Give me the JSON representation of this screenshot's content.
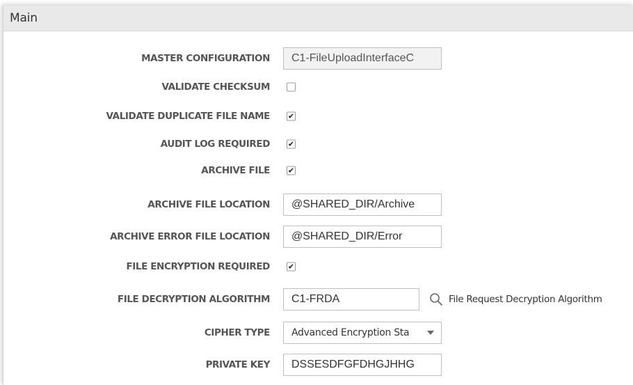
{
  "section": {
    "title": "Main"
  },
  "fields": {
    "master_configuration": {
      "label": "MASTER CONFIGURATION",
      "value": "C1-FileUploadInterfaceC"
    },
    "validate_checksum": {
      "label": "VALIDATE CHECKSUM",
      "checked": false
    },
    "validate_duplicate_file_name": {
      "label": "VALIDATE DUPLICATE FILE NAME",
      "checked": true
    },
    "audit_log_required": {
      "label": "AUDIT LOG REQUIRED",
      "checked": true
    },
    "archive_file": {
      "label": "ARCHIVE FILE",
      "checked": true
    },
    "archive_file_location": {
      "label": "ARCHIVE FILE LOCATION",
      "value": "@SHARED_DIR/Archive"
    },
    "archive_error_file_location": {
      "label": "ARCHIVE ERROR FILE LOCATION",
      "value": "@SHARED_DIR/Error"
    },
    "file_encryption_required": {
      "label": "FILE ENCRYPTION REQUIRED",
      "checked": true
    },
    "file_decryption_algorithm": {
      "label": "FILE DECRYPTION ALGORITHM",
      "value": "C1-FRDA",
      "description": "File Request Decryption Algorithm",
      "search_icon": "search-icon"
    },
    "cipher_type": {
      "label": "CIPHER TYPE",
      "value": "Advanced Encryption Sta"
    },
    "private_key": {
      "label": "PRIVATE KEY",
      "value": "DSSESDFGFDHGJHHG"
    }
  },
  "check_glyph": "✔"
}
